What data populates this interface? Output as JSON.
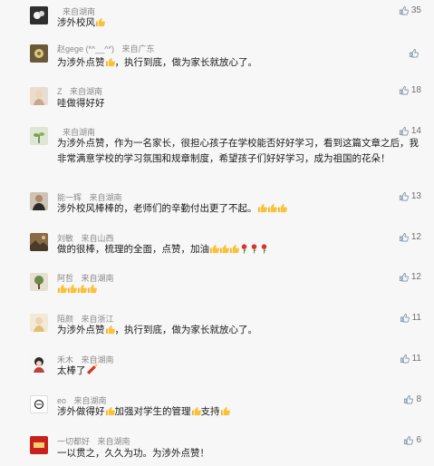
{
  "comments": [
    {
      "avatar_icon": "avatar-dark-flower",
      "name": "",
      "region": "来自湖南",
      "text": "涉外校风",
      "emoji_after": "thumbs-up",
      "likes": "35"
    },
    {
      "avatar_icon": "avatar-flower",
      "name": "赵gege (*^__^*)",
      "region": "来自广东",
      "text_parts": [
        "为涉外点赞",
        "，执行到底，做为家长就放心了。"
      ],
      "likes": ""
    },
    {
      "avatar_icon": "avatar-girl",
      "name": "Z",
      "region": "来自湖南",
      "text": "哇做得好好",
      "likes": "18"
    },
    {
      "avatar_icon": "avatar-plant",
      "name": "",
      "region": "来自湖南",
      "text": "为涉外点赞，作为一名家长，很担心孩子在学校能否好好学习，看到这篇文章之后，我非常满意学校的学习氛围和规章制度，希望孩子们好好学习，成为祖国的花朵！",
      "likes": "14"
    },
    {
      "avatar_icon": "avatar-man",
      "name": "能一辉",
      "region": "来自湖南",
      "text": "涉外校风棒棒的，老师们的辛勤付出更了不起。",
      "likes": "13"
    },
    {
      "avatar_icon": "avatar-landscape",
      "name": "刘敏",
      "region": "来自山西",
      "text": "做的很棒，梳理的全面，点赞，加油",
      "likes": "12"
    },
    {
      "avatar_icon": "avatar-tree",
      "name": "阿哲",
      "region": "来自湖南",
      "text": "",
      "likes": "12"
    },
    {
      "avatar_icon": "avatar-child",
      "name": "陌颜",
      "region": "来自浙江",
      "text_parts": [
        "为涉外点赞",
        "，执行到底，做为家长就放心了。"
      ],
      "likes": "11"
    },
    {
      "avatar_icon": "avatar-cartoon",
      "name": "禾木",
      "region": "来自湖南",
      "text": "太棒了",
      "likes": "11"
    },
    {
      "avatar_icon": "avatar-eo",
      "name": "eo",
      "region": "来自湖南",
      "text_parts": [
        "涉外做得好",
        "加强对学生的管理",
        "支持"
      ],
      "likes": "8"
    },
    {
      "avatar_icon": "avatar-red-logo",
      "name": "一切都好",
      "region": "来自湖南",
      "text": "一以贯之，久久为功。为涉外点赞！",
      "likes": "6"
    }
  ]
}
